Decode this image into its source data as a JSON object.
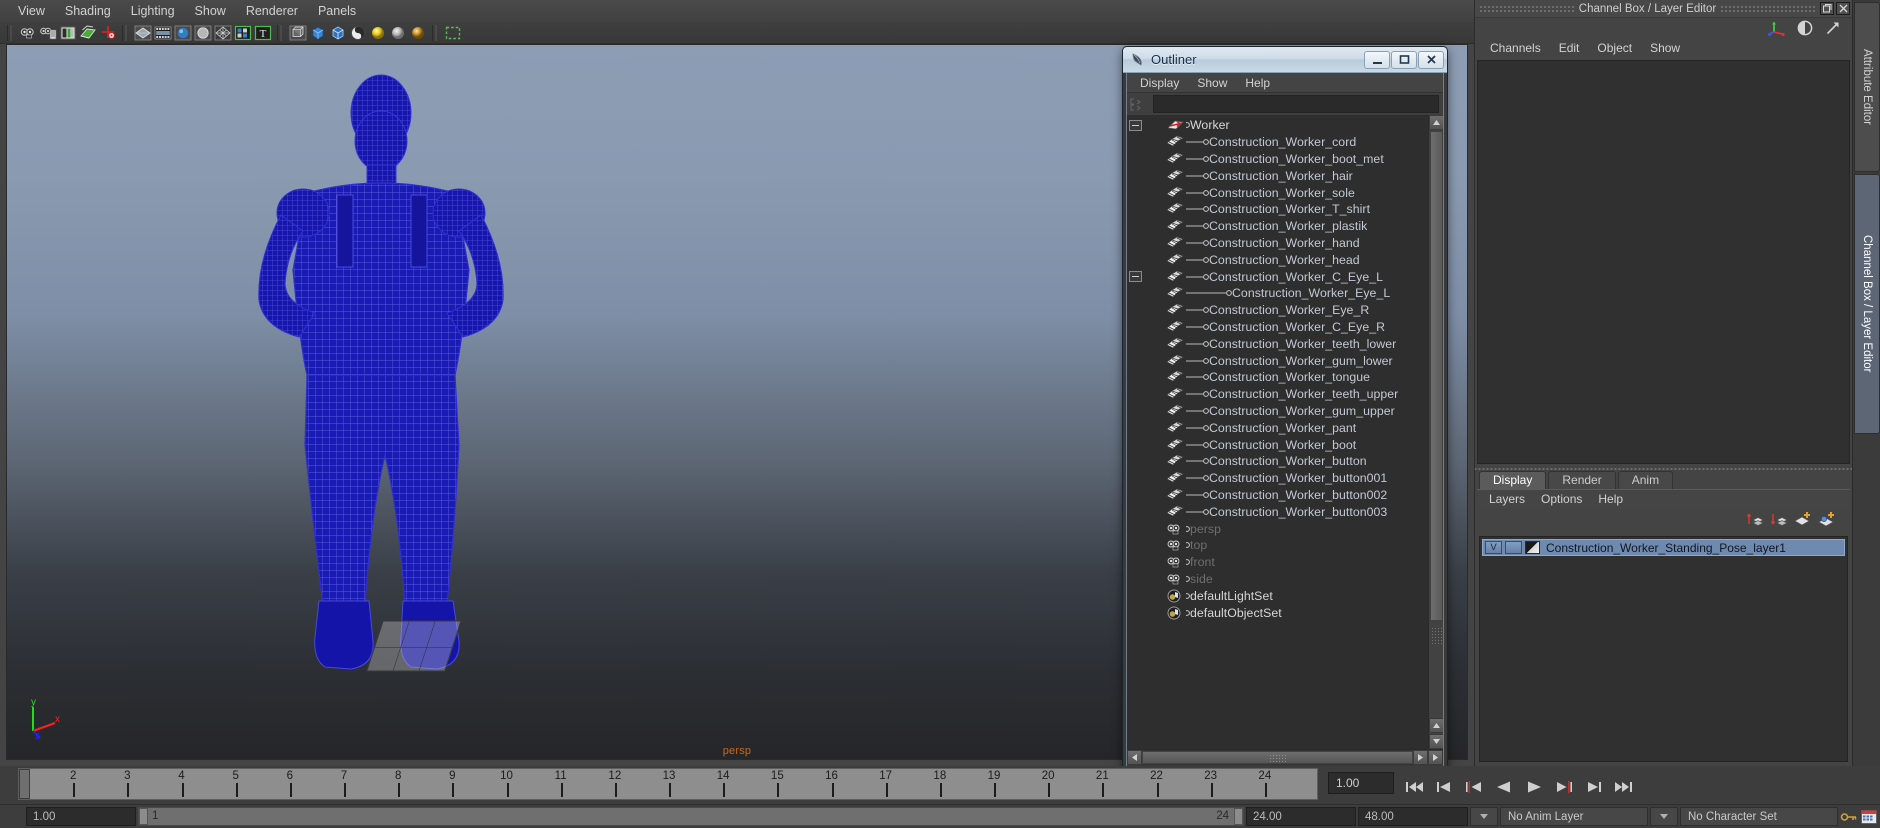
{
  "viewport": {
    "menus": [
      "View",
      "Shading",
      "Lighting",
      "Show",
      "Renderer",
      "Panels"
    ],
    "toolbar_icons": [
      "camera-attributes-icon",
      "camera-settings-icon",
      "image-plane-icon",
      "grid-display-icon",
      "manipulator-icon",
      "wireframe-shaded-icon",
      "film-gate-icon",
      "smooth-shade-icon",
      "flat-shade-icon",
      "wireframe-on-shaded-icon",
      "texture-display-icon",
      "lighting-text-icon",
      "xray-mode-icon",
      "shaded-box-icon",
      "bounding-box-icon",
      "high-quality-render-icon",
      "light-yellow-icon",
      "light-grey-icon",
      "light-amber-icon",
      "isolate-select-icon"
    ],
    "camera_label": "persp",
    "axis_gizmo": {
      "x_label": "x",
      "y_label": "y",
      "z_label": "z",
      "x_color": "#ff2020",
      "y_color": "#20dd20",
      "z_color": "#2020ff"
    }
  },
  "outliner": {
    "title": "Outliner",
    "window_icon": "outliner-window-icon",
    "buttons": {
      "minimize": "minimize-button",
      "maximize": "maximize-button",
      "close": "close-button"
    },
    "menus": [
      "Display",
      "Show",
      "Help"
    ],
    "search_placeholder": "",
    "search_value": "",
    "tree": [
      {
        "label": "Worker",
        "icon": "transform-group-icon",
        "indent": 0,
        "expander": "minus",
        "kind": "root"
      },
      {
        "label": "Construction_Worker_cord",
        "icon": "mesh-icon",
        "indent": 1,
        "expander": "none",
        "kind": "mesh"
      },
      {
        "label": "Construction_Worker_boot_met",
        "icon": "mesh-icon",
        "indent": 1,
        "expander": "none",
        "kind": "mesh"
      },
      {
        "label": "Construction_Worker_hair",
        "icon": "mesh-icon",
        "indent": 1,
        "expander": "none",
        "kind": "mesh"
      },
      {
        "label": "Construction_Worker_sole",
        "icon": "mesh-icon",
        "indent": 1,
        "expander": "none",
        "kind": "mesh"
      },
      {
        "label": "Construction_Worker_T_shirt",
        "icon": "mesh-icon",
        "indent": 1,
        "expander": "none",
        "kind": "mesh"
      },
      {
        "label": "Construction_Worker_plastik",
        "icon": "mesh-icon",
        "indent": 1,
        "expander": "none",
        "kind": "mesh"
      },
      {
        "label": "Construction_Worker_hand",
        "icon": "mesh-icon",
        "indent": 1,
        "expander": "none",
        "kind": "mesh"
      },
      {
        "label": "Construction_Worker_head",
        "icon": "mesh-icon",
        "indent": 1,
        "expander": "none",
        "kind": "mesh"
      },
      {
        "label": "Construction_Worker_C_Eye_L",
        "icon": "mesh-icon",
        "indent": 1,
        "expander": "minus",
        "kind": "mesh"
      },
      {
        "label": "Construction_Worker_Eye_L",
        "icon": "mesh-icon",
        "indent": 2,
        "expander": "none",
        "kind": "mesh"
      },
      {
        "label": "Construction_Worker_Eye_R",
        "icon": "mesh-icon",
        "indent": 1,
        "expander": "none",
        "kind": "mesh"
      },
      {
        "label": "Construction_Worker_C_Eye_R",
        "icon": "mesh-icon",
        "indent": 1,
        "expander": "none",
        "kind": "mesh"
      },
      {
        "label": "Construction_Worker_teeth_lower",
        "icon": "mesh-icon",
        "indent": 1,
        "expander": "none",
        "kind": "mesh"
      },
      {
        "label": "Construction_Worker_gum_lower",
        "icon": "mesh-icon",
        "indent": 1,
        "expander": "none",
        "kind": "mesh"
      },
      {
        "label": "Construction_Worker_tongue",
        "icon": "mesh-icon",
        "indent": 1,
        "expander": "none",
        "kind": "mesh"
      },
      {
        "label": "Construction_Worker_teeth_upper",
        "icon": "mesh-icon",
        "indent": 1,
        "expander": "none",
        "kind": "mesh"
      },
      {
        "label": "Construction_Worker_gum_upper",
        "icon": "mesh-icon",
        "indent": 1,
        "expander": "none",
        "kind": "mesh"
      },
      {
        "label": "Construction_Worker_pant",
        "icon": "mesh-icon",
        "indent": 1,
        "expander": "none",
        "kind": "mesh"
      },
      {
        "label": "Construction_Worker_boot",
        "icon": "mesh-icon",
        "indent": 1,
        "expander": "none",
        "kind": "mesh"
      },
      {
        "label": "Construction_Worker_button",
        "icon": "mesh-icon",
        "indent": 1,
        "expander": "none",
        "kind": "mesh"
      },
      {
        "label": "Construction_Worker_button001",
        "icon": "mesh-icon",
        "indent": 1,
        "expander": "none",
        "kind": "mesh"
      },
      {
        "label": "Construction_Worker_button002",
        "icon": "mesh-icon",
        "indent": 1,
        "expander": "none",
        "kind": "mesh"
      },
      {
        "label": "Construction_Worker_button003",
        "icon": "mesh-icon",
        "indent": 1,
        "expander": "none",
        "kind": "mesh"
      },
      {
        "label": "persp",
        "icon": "camera-icon",
        "indent": 0,
        "expander": "none",
        "kind": "camera"
      },
      {
        "label": "top",
        "icon": "camera-icon",
        "indent": 0,
        "expander": "none",
        "kind": "camera"
      },
      {
        "label": "front",
        "icon": "camera-icon",
        "indent": 0,
        "expander": "none",
        "kind": "camera"
      },
      {
        "label": "side",
        "icon": "camera-icon",
        "indent": 0,
        "expander": "none",
        "kind": "camera"
      },
      {
        "label": "defaultLightSet",
        "icon": "set-icon",
        "indent": 0,
        "expander": "none",
        "kind": "set"
      },
      {
        "label": "defaultObjectSet",
        "icon": "set-icon",
        "indent": 0,
        "expander": "none",
        "kind": "set"
      }
    ]
  },
  "right_dock": {
    "title": "Channel Box / Layer Editor",
    "window_buttons": [
      "restore-button",
      "close-button"
    ],
    "header_icons": [
      "move-manipulator-icon",
      "half-circle-toggle-icon",
      "arrow-diagonal-icon"
    ],
    "channelbox": {
      "menus": [
        "Channels",
        "Edit",
        "Object",
        "Show"
      ],
      "content": ""
    },
    "layer_editor": {
      "tabs": [
        "Display",
        "Render",
        "Anim"
      ],
      "active_tab": "Display",
      "menus": [
        "Layers",
        "Options",
        "Help"
      ],
      "toolbar_icons": [
        "move-layer-up-icon",
        "move-layer-down-icon",
        "new-layer-icon",
        "new-layer-from-selected-icon"
      ],
      "layers": [
        {
          "visibility": "V",
          "playback": "",
          "color_swatch": "layer-color-swatch",
          "name": "Construction_Worker_Standing_Pose_layer1",
          "selected": true
        }
      ]
    }
  },
  "vertical_tabs": [
    {
      "label": "Attribute Editor",
      "active": false
    },
    {
      "label": "Channel Box / Layer Editor",
      "active": true
    }
  ],
  "time_slider": {
    "tick_labels": [
      "2",
      "3",
      "4",
      "5",
      "6",
      "7",
      "8",
      "9",
      "10",
      "11",
      "12",
      "13",
      "14",
      "15",
      "16",
      "17",
      "18",
      "19",
      "20",
      "21",
      "22",
      "23",
      "24"
    ],
    "current_frame": "1.00",
    "playback_buttons": [
      "go-to-start-icon",
      "step-back-frame-icon",
      "step-back-key-icon",
      "play-backwards-icon",
      "play-forwards-icon",
      "step-forward-key-icon",
      "step-forward-frame-icon",
      "go-to-end-icon"
    ]
  },
  "range_slider": {
    "start_field": "1.00",
    "range_start_label": "1",
    "range_end_label": "24",
    "end_field": "24.00",
    "playback_end_field": "48.00",
    "anim_layer": "No Anim Layer",
    "character_set": "No Character Set",
    "right_icons": [
      "auto-key-icon",
      "animation-preferences-icon"
    ]
  }
}
